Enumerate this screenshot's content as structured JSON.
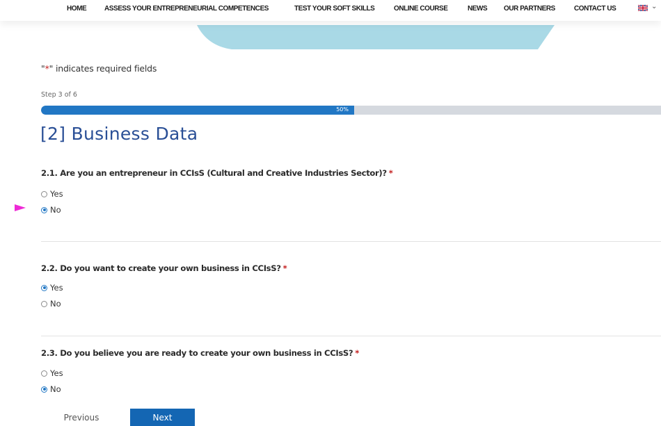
{
  "nav": {
    "items": [
      {
        "label": "HOME"
      },
      {
        "label": "ASSESS YOUR ENTREPRENEURIAL COMPETENCES"
      },
      {
        "label": "TEST YOUR SOFT SKILLS"
      },
      {
        "label": "ONLINE COURSE"
      },
      {
        "label": "NEWS"
      },
      {
        "label": "OUR PARTNERS"
      },
      {
        "label": "CONTACT US"
      }
    ],
    "language_icon": "uk-flag-icon",
    "language_chevron": "⌄"
  },
  "form": {
    "required_note": {
      "prefix": "\"",
      "star": "*",
      "suffix": "\" indicates required fields"
    },
    "step_label": "Step 3 of 6",
    "progress": {
      "percent": 50,
      "text": "50%"
    },
    "section_title": "[2] Business Data",
    "questions": [
      {
        "text": "2.1. Are you an entrepreneur in CCIsS (Cultural and Creative Industries Sector)?",
        "required_mark": "*",
        "options": [
          {
            "label": "Yes",
            "checked": false
          },
          {
            "label": "No",
            "checked": true
          }
        ]
      },
      {
        "text": "2.2. Do you want to create your own business in CCIsS?",
        "required_mark": "*",
        "options": [
          {
            "label": "Yes",
            "checked": true
          },
          {
            "label": "No",
            "checked": false
          }
        ]
      },
      {
        "text": "2.3. Do you believe you are ready to create your own business in CCIsS?",
        "required_mark": "*",
        "options": [
          {
            "label": "Yes",
            "checked": false
          },
          {
            "label": "No",
            "checked": true
          }
        ]
      }
    ],
    "buttons": {
      "previous": "Previous",
      "next": "Next"
    }
  },
  "colors": {
    "accent": "#2177c4",
    "title": "#2a4f96",
    "next_button": "#1466b3",
    "hero": "#a9d9e6",
    "pointer": "#ee2ad6",
    "required": "#c42121"
  }
}
